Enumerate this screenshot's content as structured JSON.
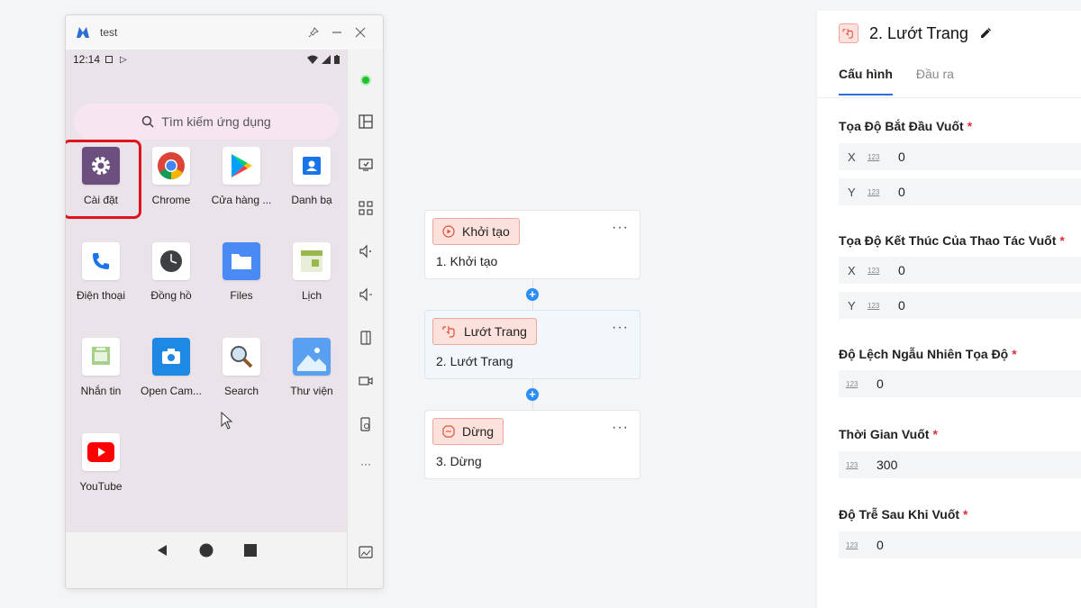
{
  "emulator": {
    "title": "test",
    "status_time": "12:14",
    "search_placeholder": "Tìm kiếm ứng dụng",
    "apps": [
      {
        "label": "Cài đặt",
        "icon": "settings-icon"
      },
      {
        "label": "Chrome",
        "icon": "chrome-icon"
      },
      {
        "label": "Cửa hàng ...",
        "icon": "play-store-icon"
      },
      {
        "label": "Danh bạ",
        "icon": "contacts-icon"
      },
      {
        "label": "Điện thoại",
        "icon": "phone-icon"
      },
      {
        "label": "Đồng hồ",
        "icon": "clock-icon"
      },
      {
        "label": "Files",
        "icon": "files-icon"
      },
      {
        "label": "Lịch",
        "icon": "calendar-icon"
      },
      {
        "label": "Nhắn tin",
        "icon": "messages-icon"
      },
      {
        "label": "Open Cam...",
        "icon": "camera-icon"
      },
      {
        "label": "Search",
        "icon": "search-app-icon"
      },
      {
        "label": "Thư viện",
        "icon": "gallery-icon"
      },
      {
        "label": "YouTube",
        "icon": "youtube-icon"
      }
    ]
  },
  "flow": {
    "nodes": [
      {
        "tag": "Khởi tạo",
        "title": "1. Khởi tạo"
      },
      {
        "tag": "Lướt Trang",
        "title": "2. Lướt Trang"
      },
      {
        "tag": "Dừng",
        "title": "3. Dừng"
      }
    ],
    "more": "···"
  },
  "panel": {
    "title": "2. Lướt Trang",
    "tabs": [
      "Cấu hình",
      "Đầu ra"
    ],
    "number_badge": "123",
    "required_mark": "*",
    "fields": {
      "start_label": "Tọa Độ Bắt Đầu Vuốt",
      "start_x_axis": "X",
      "start_x": "0",
      "start_y_axis": "Y",
      "start_y": "0",
      "end_label": "Tọa Độ Kết Thúc Của Thao Tác Vuốt",
      "end_x_axis": "X",
      "end_x": "0",
      "end_y_axis": "Y",
      "end_y": "0",
      "random_label": "Độ Lệch Ngẫu Nhiên Tọa Độ",
      "random_value": "0",
      "time_label": "Thời Gian Vuốt",
      "time_value": "300",
      "delay_label": "Độ Trễ Sau Khi Vuốt",
      "delay_value": "0"
    }
  },
  "colors": {
    "accent": "#2b6fd6",
    "tag_bg": "#fde1dc",
    "tag_border": "#f0a79b",
    "highlight": "#e0141e",
    "required": "#e0303a"
  }
}
